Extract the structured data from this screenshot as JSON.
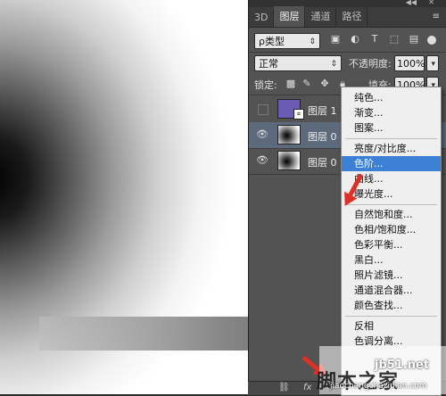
{
  "panel": {
    "tabs": [
      "3D",
      "图层",
      "通道",
      "路径"
    ],
    "active_tab": "图层",
    "filter_kind": "ρ类型",
    "blend_mode": "正常",
    "opacity_label": "不透明度:",
    "opacity_value": "100%",
    "lock_label": "锁定:",
    "fill_label": "填充:",
    "fill_value": "100%"
  },
  "layers": [
    {
      "name": "图层 1",
      "thumb": "color",
      "visible": false,
      "selected": false
    },
    {
      "name": "图层 0",
      "thumb": "gradient",
      "visible": true,
      "selected": true
    },
    {
      "name": "图层 0",
      "thumb": "gradient",
      "visible": true,
      "selected": false
    }
  ],
  "menu": {
    "group1": [
      "纯色...",
      "渐变...",
      "图案..."
    ],
    "group2": [
      "亮度/对比度...",
      "色阶...",
      "曲线...",
      "曝光度..."
    ],
    "group3": [
      "自然饱和度...",
      "色相/饱和度...",
      "色彩平衡...",
      "黑白...",
      "照片滤镜...",
      "通道混合器...",
      "颜色查找..."
    ],
    "group4": [
      "反相",
      "色调分离..."
    ],
    "highlighted": "色阶..."
  },
  "bottom_icons": [
    "link-icon",
    "fx-icon"
  ],
  "watermark": {
    "url": "jb51.net",
    "text": "脚本之家",
    "sub": "jiaochengchazidian.com"
  },
  "colors": {
    "panel_bg": "#535353",
    "menu_highlight": "#3b80d4",
    "arrow": "#e03025",
    "selected_layer": "#5d6a7c"
  }
}
